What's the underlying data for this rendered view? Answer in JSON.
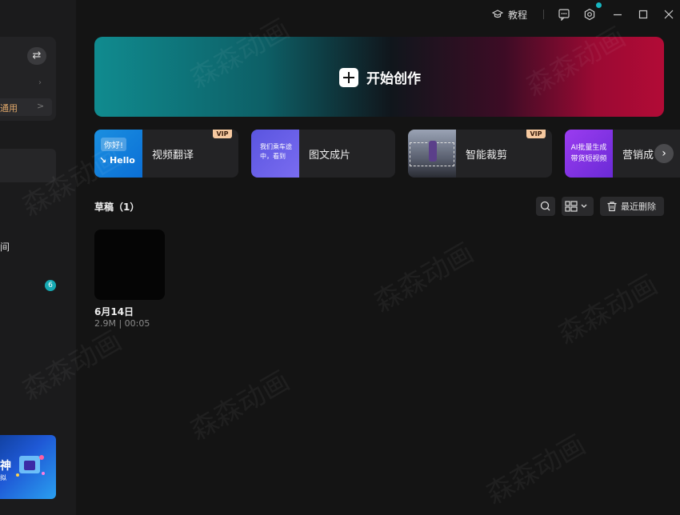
{
  "topbar": {
    "tutorial_label": "教程"
  },
  "sidebar": {
    "row_label": "通用",
    "text_jian": "间",
    "badge_count": "6",
    "banner_title": "神",
    "banner_sub": "拟"
  },
  "hero": {
    "label": "开始创作"
  },
  "tools": [
    {
      "label": "视频翻译",
      "vip": "VIP",
      "thumb_text1": "你好!",
      "thumb_text2": "Hello"
    },
    {
      "label": "图文成片",
      "thumb_text1": "我们乘车途",
      "thumb_text2": "中，看到"
    },
    {
      "label": "智能裁剪",
      "vip": "VIP"
    },
    {
      "label": "营销成",
      "thumb_text1": "AI批量生成",
      "thumb_text2": "带货短视频"
    }
  ],
  "drafts": {
    "title": "草稿（1）",
    "recent_delete_label": "最近删除",
    "items": [
      {
        "name": "6月14日",
        "meta": "2.9M | 00:05"
      }
    ]
  },
  "watermark": "森森动画",
  "colors": {
    "accent_teal": "#17b6c1",
    "vip_bg": "#f6c9a0"
  }
}
